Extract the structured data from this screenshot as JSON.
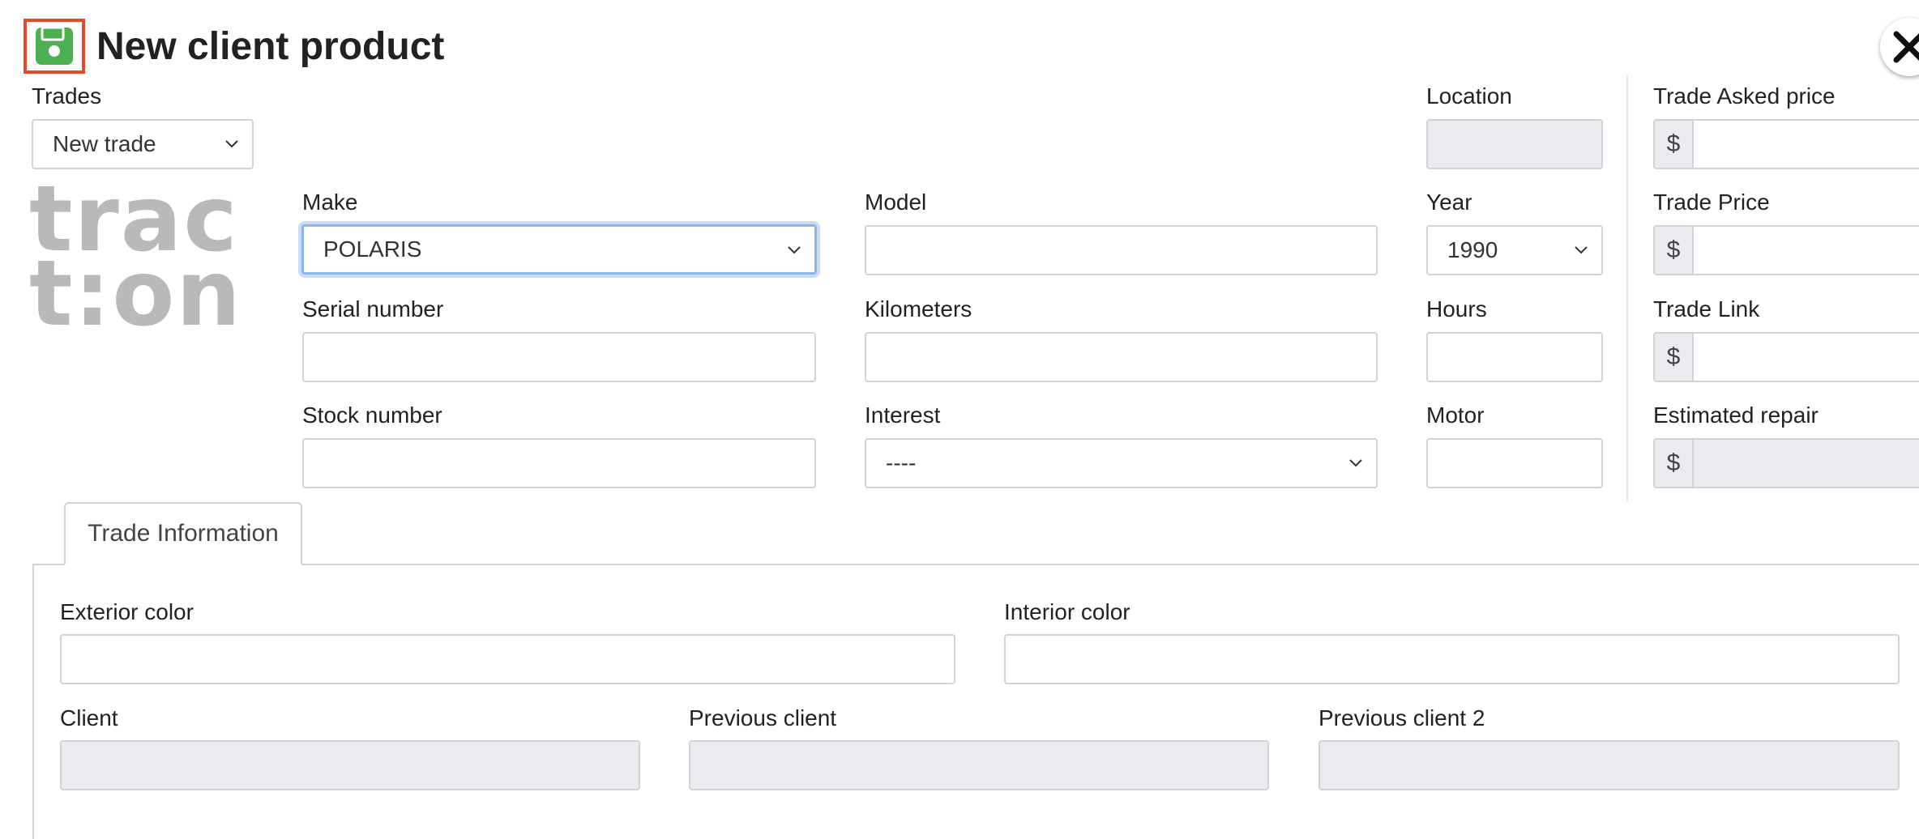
{
  "header": {
    "title": "New client product",
    "save_icon": "floppy-disk-icon",
    "close_icon": "close-icon",
    "accent_green": "#4caf50",
    "highlight_red": "#e5492b"
  },
  "trades": {
    "label": "Trades",
    "selected": "New trade"
  },
  "logo": {
    "line1": "trac",
    "line2": "t:on"
  },
  "form": {
    "location_label": "Location",
    "make_label": "Make",
    "make_value": "POLARIS",
    "model_label": "Model",
    "model_value": "",
    "year_label": "Year",
    "year_value": "1990",
    "serial_label": "Serial number",
    "serial_value": "",
    "kilometers_label": "Kilometers",
    "kilometers_value": "",
    "hours_label": "Hours",
    "hours_value": "",
    "stock_label": "Stock number",
    "stock_value": "",
    "interest_label": "Interest",
    "interest_value": "----",
    "motor_label": "Motor",
    "motor_value": ""
  },
  "pricing": {
    "currency": "$",
    "asked_label": "Trade Asked price",
    "price_label": "Trade Price",
    "link_label": "Trade Link",
    "repair_label": "Estimated repair"
  },
  "tabs": {
    "trade_info": "Trade Information"
  },
  "trade_info": {
    "exterior_label": "Exterior color",
    "exterior_value": "",
    "interior_label": "Interior color",
    "interior_value": "",
    "client_label": "Client",
    "previous_client_label": "Previous client",
    "previous_client2_label": "Previous client 2"
  }
}
